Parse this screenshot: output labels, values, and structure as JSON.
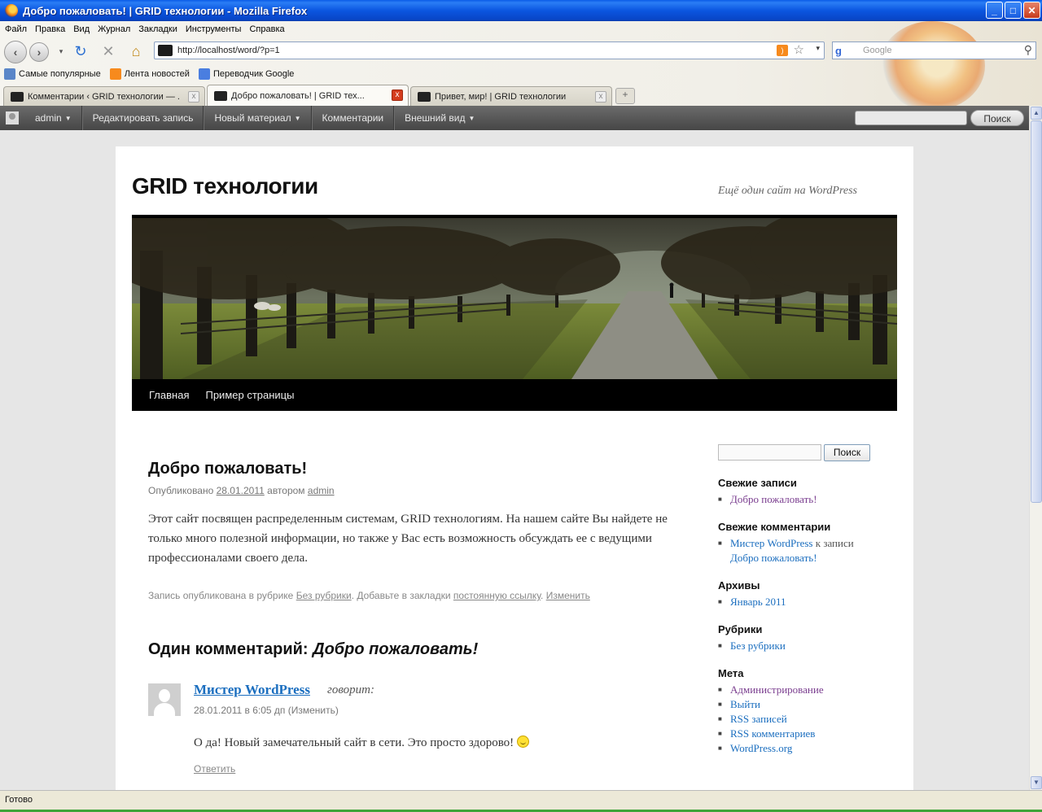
{
  "window": {
    "title": "Добро пожаловать! | GRID технологии - Mozilla Firefox",
    "controls": {
      "minimize": "_",
      "maximize": "□",
      "close": "✕"
    }
  },
  "menu": [
    "Файл",
    "Правка",
    "Вид",
    "Журнал",
    "Закладки",
    "Инструменты",
    "Справка"
  ],
  "toolbar": {
    "url": "http://localhost/word/?p=1",
    "search_placeholder": "Google",
    "icons": [
      "back-icon",
      "forward-icon",
      "reload-icon",
      "stop-icon",
      "home-icon",
      "rss-icon",
      "star-icon",
      "search-icon"
    ]
  },
  "bookmarks": [
    "Самые популярные",
    "Лента новостей",
    "Переводчик Google"
  ],
  "tabs": [
    {
      "label": "Комментарии ‹ GRID технологии — ...",
      "active": false
    },
    {
      "label": "Добро пожаловать! | GRID тех...",
      "active": true
    },
    {
      "label": "Привет, мир! | GRID технологии",
      "active": false
    }
  ],
  "newtab_label": "+",
  "wp_admin_bar": {
    "items": [
      "admin",
      "Редактировать запись",
      "Новый материал",
      "Комментарии",
      "Внешний вид"
    ],
    "search_button": "Поиск"
  },
  "site": {
    "title": "GRID технологии",
    "description": "Ещё один сайт на WordPress",
    "nav": [
      "Главная",
      "Пример страницы"
    ]
  },
  "post": {
    "title": "Добро пожаловать!",
    "meta_prefix": "Опубликовано",
    "date": "28.01.2011",
    "meta_author_prefix": "автором",
    "author": "admin",
    "body": "Этот сайт посвящен распределенным системам, GRID технологиям. На нашем сайте Вы найдете не только много полезной информации, но также  у Вас есть возможность обсуждать ее с ведущими профессионалами своего дела.",
    "footer_prefix": "Запись опубликована в рубрике",
    "category": "Без рубрики",
    "footer_mid": ". Добавьте в закладки",
    "permalink": "постоянную ссылку",
    "footer_sep": ".",
    "edit": "Изменить"
  },
  "comments": {
    "title_prefix": "Один комментарий:",
    "title_italic": "Добро пожаловать!",
    "items": [
      {
        "author": "Мистер WordPress",
        "says": "говорит:",
        "meta": "28.01.2011 в 6:05 дп (Изменить)",
        "text": "О да! Новый замечательный сайт в сети. Это просто здорово!",
        "reply": "Ответить"
      }
    ]
  },
  "sidebar": {
    "search_button": "Поиск",
    "recent_posts_title": "Свежие записи",
    "recent_posts": [
      "Добро пожаловать!"
    ],
    "recent_comments_title": "Свежие комментарии",
    "recent_comment_author": "Мистер WordPress",
    "recent_comment_mid": "к записи",
    "recent_comment_post": "Добро пожаловать!",
    "archives_title": "Архивы",
    "archives": [
      "Январь 2011"
    ],
    "categories_title": "Рубрики",
    "categories": [
      "Без рубрики"
    ],
    "meta_title": "Мета",
    "meta": [
      "Администрирование",
      "Выйти",
      "RSS записей",
      "RSS комментариев",
      "WordPress.org"
    ]
  },
  "status": "Готово",
  "colors": {
    "link": "#1b6ebf",
    "visited": "#7a3d8f",
    "titlebar": "#0b56e0",
    "wpbar": "#464646"
  }
}
